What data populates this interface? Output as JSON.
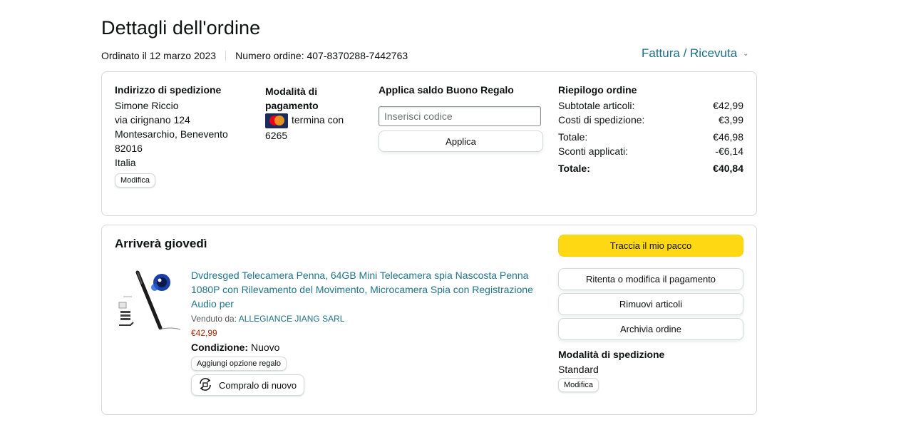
{
  "header": {
    "title": "Dettagli dell'ordine",
    "ordered_on": "Ordinato il 12 marzo 2023",
    "order_number": "Numero ordine: 407-8370288-7442763",
    "invoice_link": "Fattura / Ricevuta"
  },
  "shipping_address": {
    "heading": "Indirizzo di spedizione",
    "lines": [
      "Simone Riccio",
      "via cirignano 124",
      "Montesarchio, Benevento",
      "82016",
      "Italia"
    ],
    "edit_label": "Modifica"
  },
  "payment": {
    "heading": "Modalità di pagamento",
    "card_text": "termina con 6265",
    "card_icon": "mastercard-icon"
  },
  "gift_card": {
    "heading": "Applica saldo Buono Regalo",
    "placeholder": "Inserisci codice",
    "apply_label": "Applica"
  },
  "summary": {
    "heading": "Riepilogo ordine",
    "rows": [
      {
        "label": "Subtotale articoli:",
        "value": "€42,99"
      },
      {
        "label": "Costi di spedizione:",
        "value": "€3,99"
      },
      {
        "label": "Totale:",
        "value": "€46,98"
      },
      {
        "label": "Sconti applicati:",
        "value": "-€6,14"
      },
      {
        "label": "Totale:",
        "value": "€40,84"
      }
    ]
  },
  "shipment": {
    "heading": "Arriverà giovedì",
    "product": {
      "title": "Dvdresged Telecamera Penna, 64GB Mini Telecamera spia Nascosta Penna 1080P con Rilevamento del Movimento, Microcamera Spia con Registrazione Audio per",
      "sold_by_label": "Venduto da:",
      "seller": "ALLEGIANCE JIANG SARL",
      "price": "€42,99",
      "condition_label": "Condizione:",
      "condition_value": "Nuovo",
      "gift_option_label": "Aggiungi opzione regalo",
      "buy_again_label": "Compralo di nuovo"
    },
    "actions": {
      "track": "Traccia il mio pacco",
      "retry_payment": "Ritenta o modifica il pagamento",
      "remove_items": "Rimuovi articoli",
      "archive": "Archivia ordine"
    },
    "shipping_method_heading": "Modalità di spedizione",
    "shipping_method_value": "Standard",
    "shipping_method_edit": "Modifica"
  },
  "colors": {
    "link": "#21748a",
    "price": "#b12704",
    "primary_button": "#ffd814",
    "border": "#d5d9d9"
  }
}
